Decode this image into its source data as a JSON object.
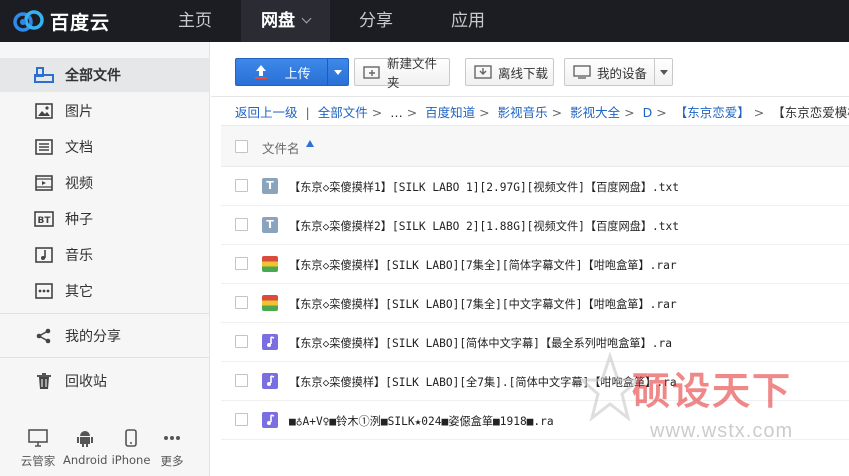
{
  "brand": {
    "name": "百度云"
  },
  "nav": [
    {
      "label": "主页"
    },
    {
      "label": "网盘"
    },
    {
      "label": "分享"
    },
    {
      "label": "应用"
    }
  ],
  "sidebar": {
    "items": [
      {
        "label": "全部文件",
        "icon": "folder-icon"
      },
      {
        "label": "图片",
        "icon": "image-icon"
      },
      {
        "label": "文档",
        "icon": "document-icon"
      },
      {
        "label": "视频",
        "icon": "video-icon"
      },
      {
        "label": "种子",
        "icon": "bt-icon"
      },
      {
        "label": "音乐",
        "icon": "music-icon"
      },
      {
        "label": "其它",
        "icon": "more-icon"
      },
      {
        "label": "我的分享",
        "icon": "share-icon"
      },
      {
        "label": "回收站",
        "icon": "trash-icon"
      }
    ],
    "devices": [
      {
        "label": "云管家",
        "icon": "monitor-icon"
      },
      {
        "label": "Android",
        "icon": "android-icon"
      },
      {
        "label": "iPhone",
        "icon": "phone-icon"
      },
      {
        "label": "更多",
        "icon": "ellipsis-icon"
      }
    ]
  },
  "toolbar": {
    "upload": "上传",
    "new_folder": "新建文件夹",
    "offline_download": "离线下载",
    "my_devices": "我的设备"
  },
  "breadcrumb": {
    "back": "返回上一级",
    "divider": "|",
    "items": [
      "全部文件",
      "…",
      "百度知道",
      "影视音乐",
      "影视大全",
      "D",
      "【东京恋爱】"
    ],
    "current": "【东京恋爱模样】"
  },
  "table": {
    "header": "文件名",
    "rows": [
      {
        "name": "【东京◇栾傻摸样1】[SILK LABO 1][2.97G][视频文件]【百度网盘】.txt",
        "type": "txt"
      },
      {
        "name": "【东京◇栾傻摸样2】[SILK LABO 2][1.88G][视频文件]【百度网盘】.txt",
        "type": "txt"
      },
      {
        "name": "【东京◇栾傻摸样】[SILK LABO][7集全][简体字幕文件]【咁咆盒箪】.rar",
        "type": "rar"
      },
      {
        "name": "【东京◇栾傻摸样】[SILK LABO][7集全][中文字幕文件]【咁咆盒箪】.rar",
        "type": "rar"
      },
      {
        "name": "【东京◇栾傻摸样】[SILK LABO][简体中文字幕]【最全系列咁咆盒箪】.ra",
        "type": "audio"
      },
      {
        "name": "【东京◇栾傻摸样】[SILK LABO][全7集].[简体中文字幕]【咁咆盒箪】.ra",
        "type": "audio"
      },
      {
        "name": "■♁A+V♀■铃木①洌■SILK★024■姿僫盒箪■1918■.ra",
        "type": "audio"
      }
    ]
  },
  "watermark": {
    "text": "硕设天下",
    "url": "www.wstx.com"
  },
  "colors": {
    "topbar": "#1c1d22",
    "accent": "#2a70d6",
    "link": "#1f63c2"
  }
}
